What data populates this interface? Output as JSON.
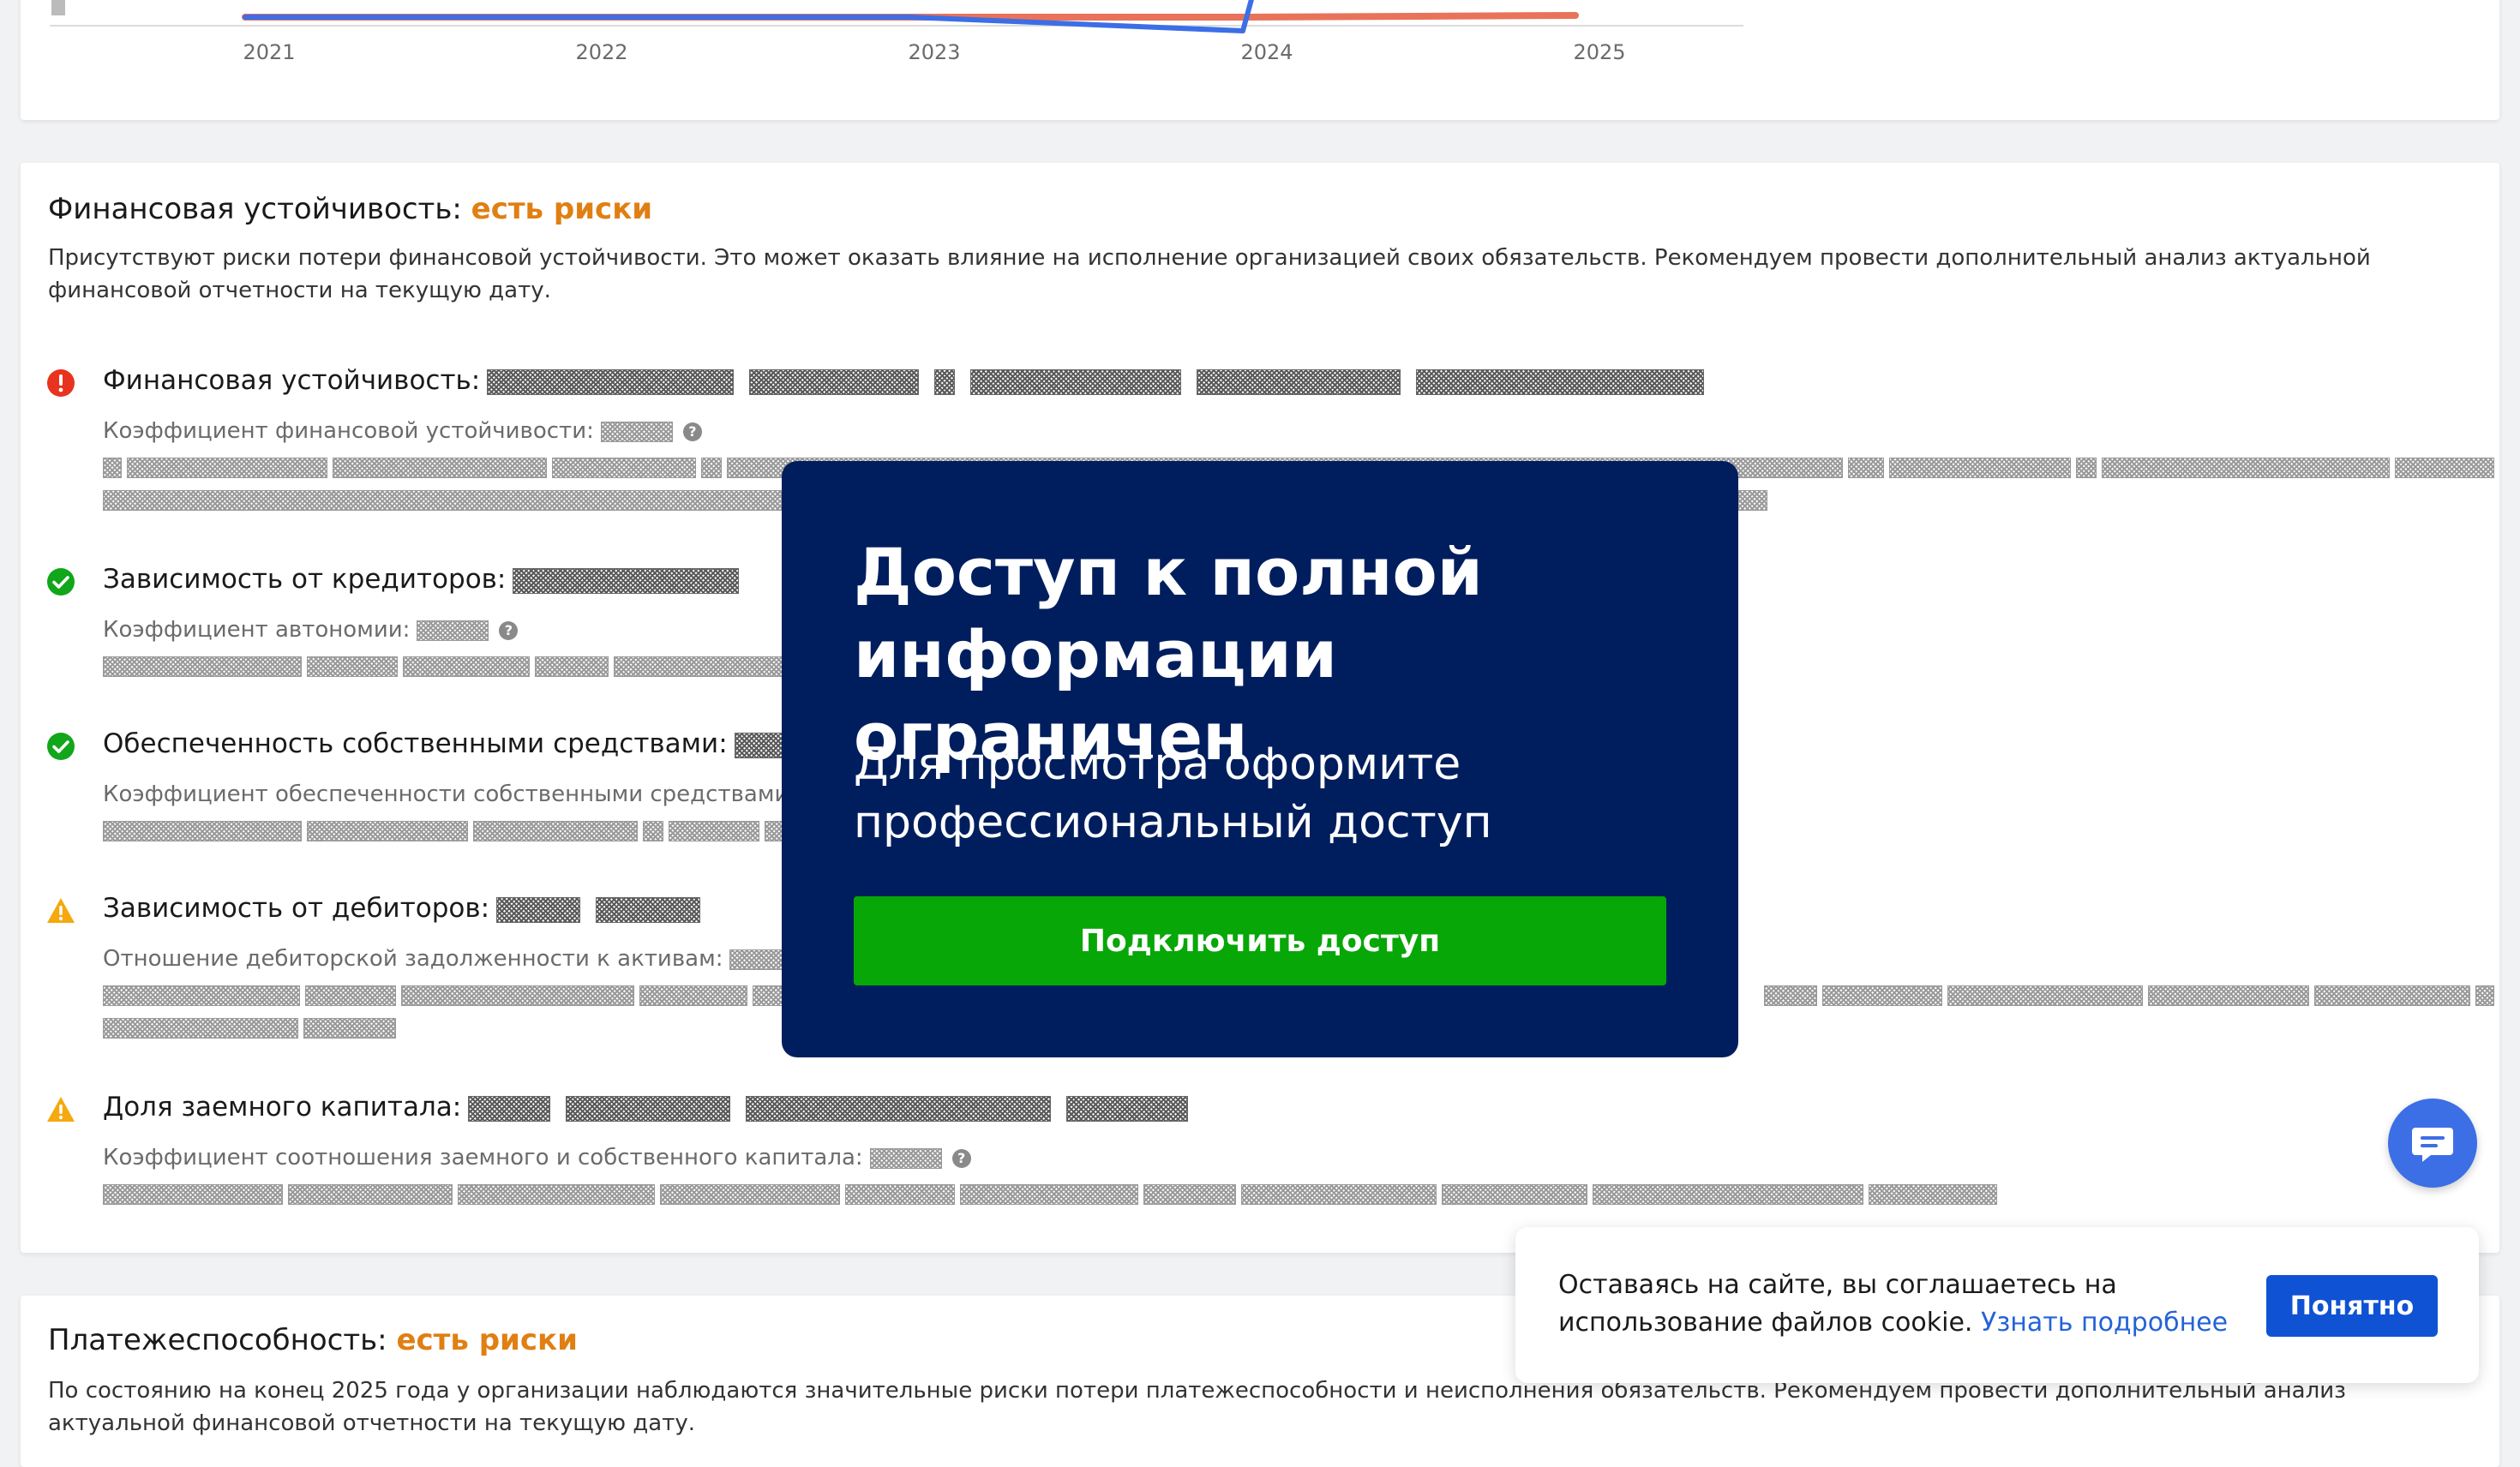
{
  "chart_data": {
    "type": "line",
    "x": [
      "2021",
      "2022",
      "2023",
      "2024",
      "2025"
    ],
    "series": [
      {
        "color": "#e8735a",
        "values": [
          0.0,
          0.0,
          0.0,
          0.0,
          0.05
        ]
      },
      {
        "color": "#3c6ee6",
        "values": [
          0.0,
          0.0,
          0.0,
          -0.4,
          null
        ]
      }
    ],
    "ylim": [
      -0.5,
      2.0
    ],
    "grid": false
  },
  "financial": {
    "title": "Финансовая устойчивость:",
    "status": "есть риски",
    "status_color": "#e07f12",
    "description": "Присутствуют риски потери финансовой устойчивости. Это может оказать влияние на исполнение организацией своих обязательств. Рекомендуем провести дополнительный анализ актуальной финансовой отчетности на текущую дату.",
    "items": [
      {
        "title": "Финансовая устойчивость:",
        "metric": "Коэффициент финансовой устойчивости:",
        "icon": "error-icon"
      },
      {
        "title": "Зависимость от кредиторов:",
        "metric": "Коэффициент автономии:",
        "icon": "check-icon"
      },
      {
        "title": "Обеспеченность собственными средствами:",
        "metric": "Коэффициент обеспеченности собственными средствами:",
        "icon": "check-icon"
      },
      {
        "title": "Зависимость от дебиторов:",
        "metric": "Отношение дебиторской задолженности к активам:",
        "icon": "warning-icon"
      },
      {
        "title": "Доля заемного капитала:",
        "metric": "Коэффициент соотношения заемного и собственного капитала:",
        "icon": "warning-icon"
      }
    ]
  },
  "solvency": {
    "title": "Платежеспособность:",
    "status": "есть риски",
    "description": "По состоянию на конец 2025 года у организации наблюдаются значительные риски потери платежеспособности и неисполнения обязательств. Рекомендуем провести дополнительный анализ актуальной финансовой отчетности на текущую дату."
  },
  "modal": {
    "title": "Доступ к полной информации ограничен",
    "subtitle": "Для просмотра оформите профессиональный доступ",
    "button": "Подключить доступ"
  },
  "cookie": {
    "text": "Оставаясь на сайте, вы соглашаетесь на использование файлов cookie.",
    "link": "Узнать подробнее",
    "button": "Понятно"
  },
  "help_glyph": "?"
}
